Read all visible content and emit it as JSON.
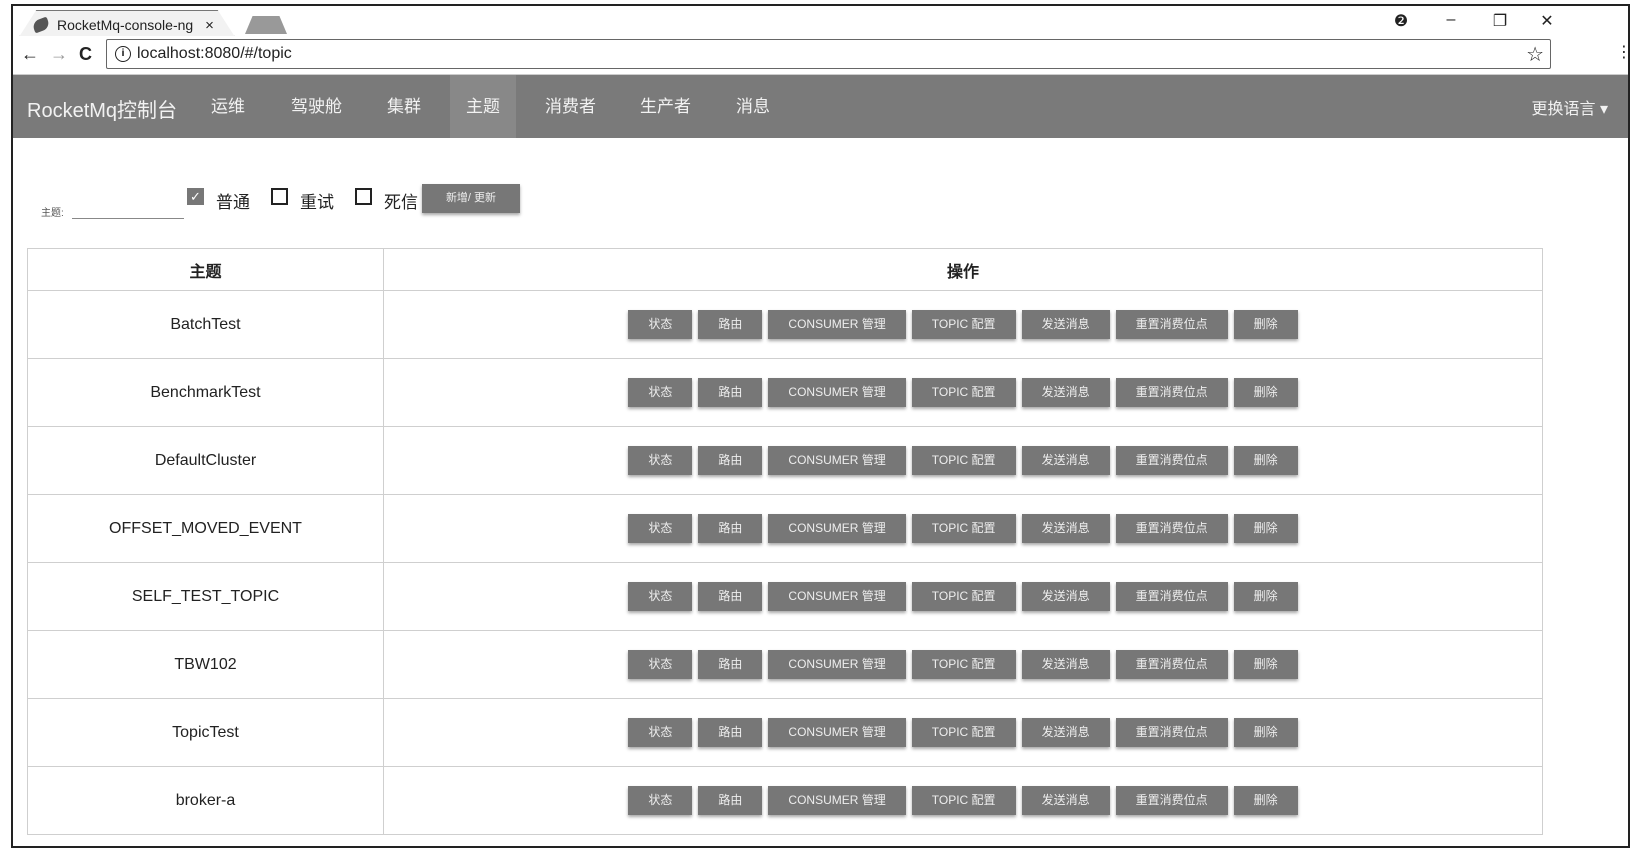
{
  "browser": {
    "tab_title": "RocketMq-console-ng",
    "tab_close": "×",
    "url": "localhost:8080/#/topic",
    "back": "←",
    "forward": "→",
    "reload": "C",
    "star": "☆",
    "menu": "⋮",
    "account": "❷",
    "minimize": "–",
    "restore": "❐",
    "close": "✕"
  },
  "navbar": {
    "brand": "RocketMq控制台",
    "items": [
      "运维",
      "驾驶舱",
      "集群",
      "主题",
      "消费者",
      "生产者",
      "消息"
    ],
    "active": "主题",
    "language": "更换语言 ▾"
  },
  "filter": {
    "label": "主题:",
    "input_value": "",
    "checkboxes": [
      {
        "label": "普通",
        "checked": true
      },
      {
        "label": "重试",
        "checked": false
      },
      {
        "label": "死信",
        "checked": false
      }
    ],
    "add_button": "新增/ 更新"
  },
  "table": {
    "headers": [
      "主题",
      "操作"
    ],
    "actions": [
      "状态",
      "路由",
      "CONSUMER 管理",
      "TOPIC 配置",
      "发送消息",
      "重置消费位点",
      "删除"
    ],
    "rows": [
      "BatchTest",
      "BenchmarkTest",
      "DefaultCluster",
      "OFFSET_MOVED_EVENT",
      "SELF_TEST_TOPIC",
      "TBW102",
      "TopicTest",
      "broker-a"
    ]
  }
}
